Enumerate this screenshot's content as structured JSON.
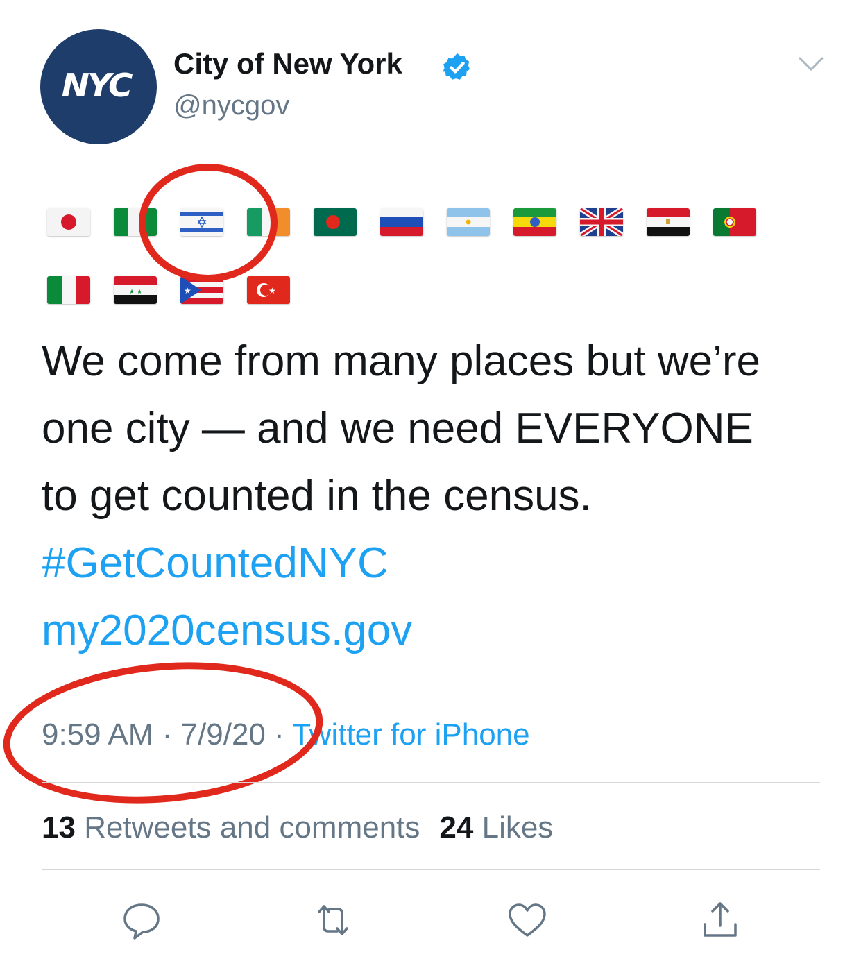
{
  "tweet": {
    "avatar_text": "NYC",
    "display_name": "City of New York",
    "handle": "@nycgov",
    "text_lines": [
      "We come from many places but we’re",
      "one city — and we need EVERYONE",
      "to get counted in the census."
    ],
    "hashtag": "#GetCountedNYC",
    "link": "my2020census.gov",
    "time": "9:59 AM",
    "separator": "·",
    "date": "7/9/20",
    "source": "Twitter for iPhone",
    "retweets_count": "13",
    "retweets_label": "Retweets and comments",
    "likes_count": "24",
    "likes_label": "Likes"
  },
  "flags": [
    "japan-flag",
    "nigeria-flag",
    "israel-flag",
    "ireland-flag",
    "bangladesh-flag",
    "russia-flag",
    "argentina-flag",
    "ethiopia-flag",
    "united-kingdom-flag",
    "egypt-flag",
    "portugal-flag",
    "italy-flag",
    "syria-flag",
    "puerto-rico-flag",
    "turkey-flag"
  ],
  "actions": [
    "reply-icon",
    "retweet-icon",
    "like-icon",
    "share-icon"
  ],
  "colors": {
    "link": "#1da1f2",
    "annotation": "#e0281c",
    "avatar": "#1f3d6b",
    "muted": "#657786"
  }
}
